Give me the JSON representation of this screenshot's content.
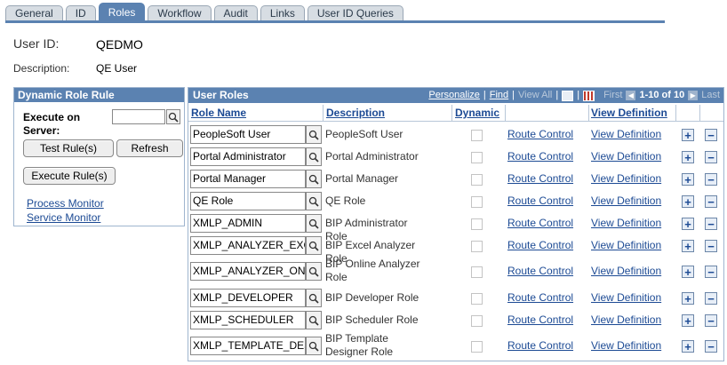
{
  "tabs": [
    {
      "label": "General"
    },
    {
      "label": "ID"
    },
    {
      "label": "Roles"
    },
    {
      "label": "Workflow"
    },
    {
      "label": "Audit"
    },
    {
      "label": "Links"
    },
    {
      "label": "User ID Queries"
    }
  ],
  "user": {
    "id_label": "User ID:",
    "id_value": "QEDMO",
    "desc_label": "Description:",
    "desc_value": "QE User"
  },
  "dynamic_role": {
    "title": "Dynamic Role Rule",
    "execute_label_1": "Execute on",
    "execute_label_2": "Server:",
    "test_rules_button": "Test Rule(s)",
    "refresh_button": "Refresh",
    "execute_rules_button": "Execute Rule(s)",
    "process_monitor_link": "Process Monitor",
    "service_monitor_link": "Service Monitor"
  },
  "grid": {
    "title": "User Roles",
    "personalize": "Personalize",
    "find": "Find",
    "view_all": "View All",
    "first": "First",
    "range": "1-10 of 10",
    "last": "Last",
    "columns": {
      "role_name": "Role Name",
      "description": "Description",
      "dynamic": "Dynamic",
      "view_definition": "View Definition"
    },
    "route_label": "Route Control",
    "view_label": "View Definition",
    "rows": [
      {
        "role": "PeopleSoft User",
        "description": "PeopleSoft User"
      },
      {
        "role": "Portal Administrator",
        "description": "Portal Administrator"
      },
      {
        "role": "Portal Manager",
        "description": "Portal Manager"
      },
      {
        "role": "QE Role",
        "description": "QE Role"
      },
      {
        "role": "XMLP_ADMIN",
        "description": "BIP Administrator Role"
      },
      {
        "role": "XMLP_ANALYZER_EXCEL",
        "description": "BIP Excel Analyzer Role"
      },
      {
        "role": "XMLP_ANALYZER_ONLINE",
        "description": "BIP Online Analyzer Role"
      },
      {
        "role": "XMLP_DEVELOPER",
        "description": "BIP Developer Role"
      },
      {
        "role": "XMLP_SCHEDULER",
        "description": "BIP Scheduler Role"
      },
      {
        "role": "XMLP_TEMPLATE_DESIGNER",
        "description": "BIP Template Designer Role"
      }
    ]
  },
  "colors": {
    "header_blue": "#5b82b1",
    "link_blue": "#1c4a94"
  },
  "icons": {
    "lookup": "magnifier-icon",
    "add": "plus-icon",
    "remove": "minus-icon"
  }
}
